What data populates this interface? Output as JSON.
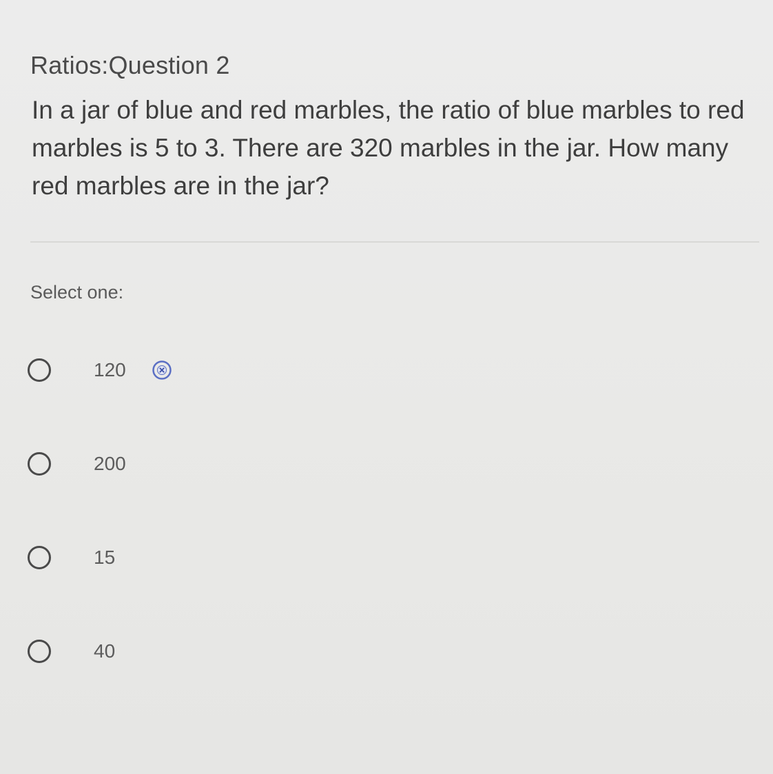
{
  "question": {
    "title": "Ratios:Question 2",
    "text": "In a jar of blue and red marbles, the ratio of blue marbles to red marbles is 5 to 3. There are 320 marbles in the jar. How many red marbles are in the jar?"
  },
  "answer_section": {
    "select_label": "Select one:",
    "options": [
      {
        "label": "120",
        "feedback_icon": "x-circle-icon"
      },
      {
        "label": "200"
      },
      {
        "label": "15"
      },
      {
        "label": "40"
      }
    ]
  },
  "colors": {
    "background": "#eaeae8",
    "text": "#3e3e3e",
    "radio_border": "#4a4a4a",
    "feedback_icon": "#5b6fc4"
  }
}
